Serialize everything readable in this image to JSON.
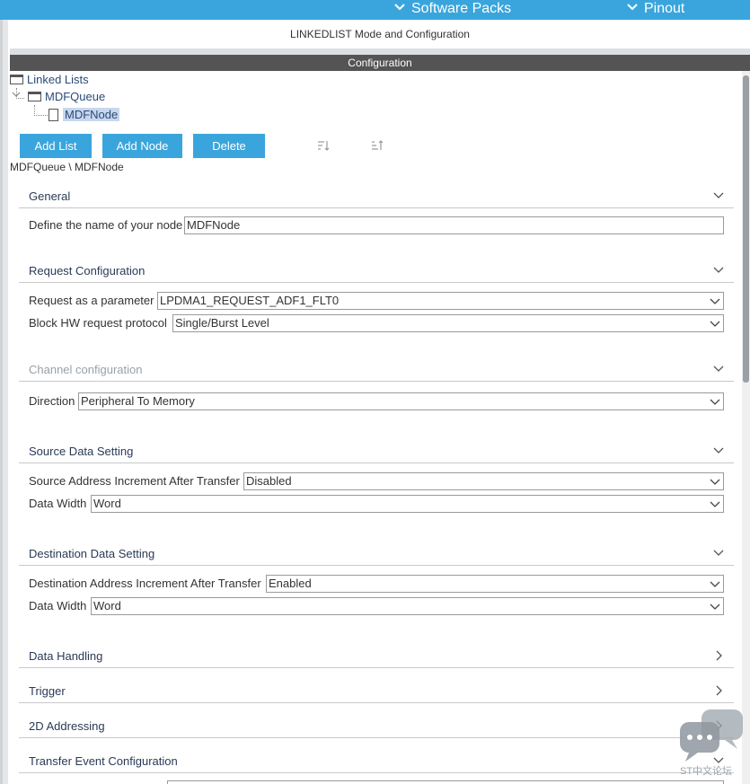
{
  "topbar": {
    "software_packs": "Software Packs",
    "pinout": "Pinout",
    "accent": "#3aa5dc"
  },
  "mode_title": "LINKEDLIST Mode and Configuration",
  "config_title": "Configuration",
  "tree": {
    "root": "Linked Lists",
    "queue": "MDFQueue",
    "node": "MDFNode"
  },
  "buttons": {
    "add_list": "Add List",
    "add_node": "Add Node",
    "delete": "Delete",
    "sort_down_icon": "sort-down-icon",
    "sort_up_icon": "sort-up-icon"
  },
  "breadcrumb": "MDFQueue \\ MDFNode",
  "sections": {
    "general": "General",
    "request": "Request Configuration",
    "channel": "Channel configuration",
    "source": "Source Data Setting",
    "destination": "Destination Data Setting",
    "data_handling": "Data Handling",
    "trigger": "Trigger",
    "addressing_2d": "2D Addressing",
    "transfer_event": "Transfer Event Configuration"
  },
  "fields": {
    "node_name_label": "Define the name of your node",
    "node_name_value": "MDFNode",
    "request_param_label": "Request as a parameter",
    "request_param_value": "LPDMA1_REQUEST_ADF1_FLT0",
    "block_hw_label": "Block HW request protocol",
    "block_hw_value": "Single/Burst Level",
    "direction_label": "Direction",
    "direction_value": "Peripheral To Memory",
    "src_incr_label": "Source Address Increment After Transfer",
    "src_incr_value": "Disabled",
    "src_width_label": "Data Width",
    "src_width_value": "Word",
    "dst_incr_label": "Destination Address Increment After Transfer",
    "dst_incr_value": "Enabled",
    "dst_width_label": "Data Width",
    "dst_width_value": "Word"
  },
  "watermark": "ST中文论坛"
}
